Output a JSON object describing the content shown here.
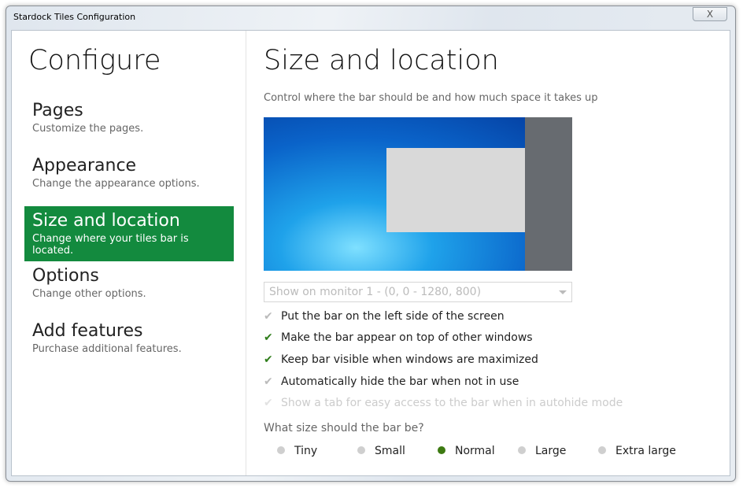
{
  "window": {
    "title": "Stardock Tiles Configuration",
    "close_label": "X"
  },
  "sidebar": {
    "heading": "Configure",
    "items": [
      {
        "title": "Pages",
        "subtitle": "Customize the pages."
      },
      {
        "title": "Appearance",
        "subtitle": "Change the appearance options."
      },
      {
        "title": "Size and location",
        "subtitle": "Change where your tiles bar is located."
      },
      {
        "title": "Options",
        "subtitle": "Change other options."
      },
      {
        "title": "Add features",
        "subtitle": "Purchase additional features."
      }
    ]
  },
  "main": {
    "title": "Size and location",
    "description": "Control where the bar should be and how much space it takes up",
    "monitor_select": "Show on monitor 1 - (0, 0 - 1280, 800)",
    "checkboxes": [
      {
        "label": "Put the bar on the left side of the screen",
        "checked": false
      },
      {
        "label": "Make the bar appear on top of other windows",
        "checked": true
      },
      {
        "label": "Keep bar visible when windows are maximized",
        "checked": true
      },
      {
        "label": "Automatically hide the bar when not in use",
        "checked": false
      },
      {
        "label": "Show a tab for easy access to the bar when in autohide mode",
        "checked": false,
        "disabled": true
      }
    ],
    "size_question": "What size should the bar be?",
    "sizes": [
      "Tiny",
      "Small",
      "Normal",
      "Large",
      "Extra large"
    ],
    "selected_size": "Normal"
  },
  "colors": {
    "accent": "#138a3e",
    "check": "#2e7d1a"
  }
}
